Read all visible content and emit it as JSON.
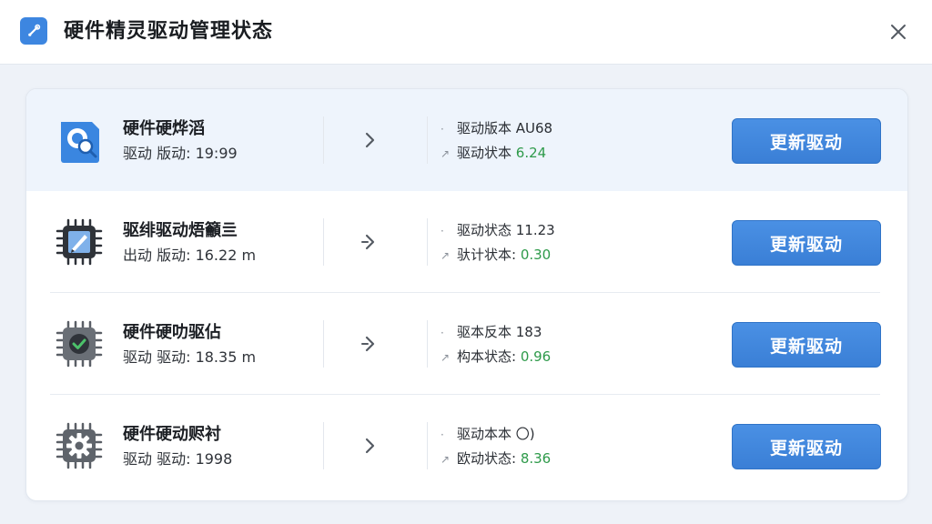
{
  "window": {
    "title": "硬件精灵驱动管理状态",
    "app_icon": "wrench-app-icon",
    "close_icon": "close-icon"
  },
  "colors": {
    "accent": "#3d86e0",
    "button": "#4289de",
    "status_green": "#2e9a4a",
    "selected_row": "#eef4fc"
  },
  "devices": [
    {
      "icon": "hardware-search-icon",
      "name": "硬件硬烨滔",
      "sub": "驱动 版动: 19:99",
      "version_mark": "·",
      "version_label": "驱动版本 AU68",
      "status_mark": "↗",
      "status_label": "驱动状本 ",
      "status_value": "6.24",
      "button": "更新驱动"
    },
    {
      "icon": "chip-edit-icon",
      "name": "驱绯驱动焐籲亖",
      "sub": "出动 版动: 16.22 m",
      "version_mark": "·",
      "version_label": "驱动状态 11.23",
      "status_mark": "↗",
      "status_label": "驮计状本: ",
      "status_value": "0.30",
      "button": "更新驱动"
    },
    {
      "icon": "chip-check-icon",
      "name": "硬件硬叻驱佔",
      "sub": "驱动 驱动: 18.35 m",
      "version_mark": "·",
      "version_label": "驱本反本 183",
      "status_mark": "↗",
      "status_label": "构本状态: ",
      "status_value": "0.96",
      "button": "更新驱动"
    },
    {
      "icon": "chip-gear-icon",
      "name": "硬件硬动赆衬",
      "sub": "驱动 驱动: 1998",
      "version_mark": "·",
      "version_label": "驱动本本 〇)",
      "status_mark": "↗",
      "status_label": "欧动状态: ",
      "status_value": "8.36",
      "button": "更新驱动"
    }
  ]
}
